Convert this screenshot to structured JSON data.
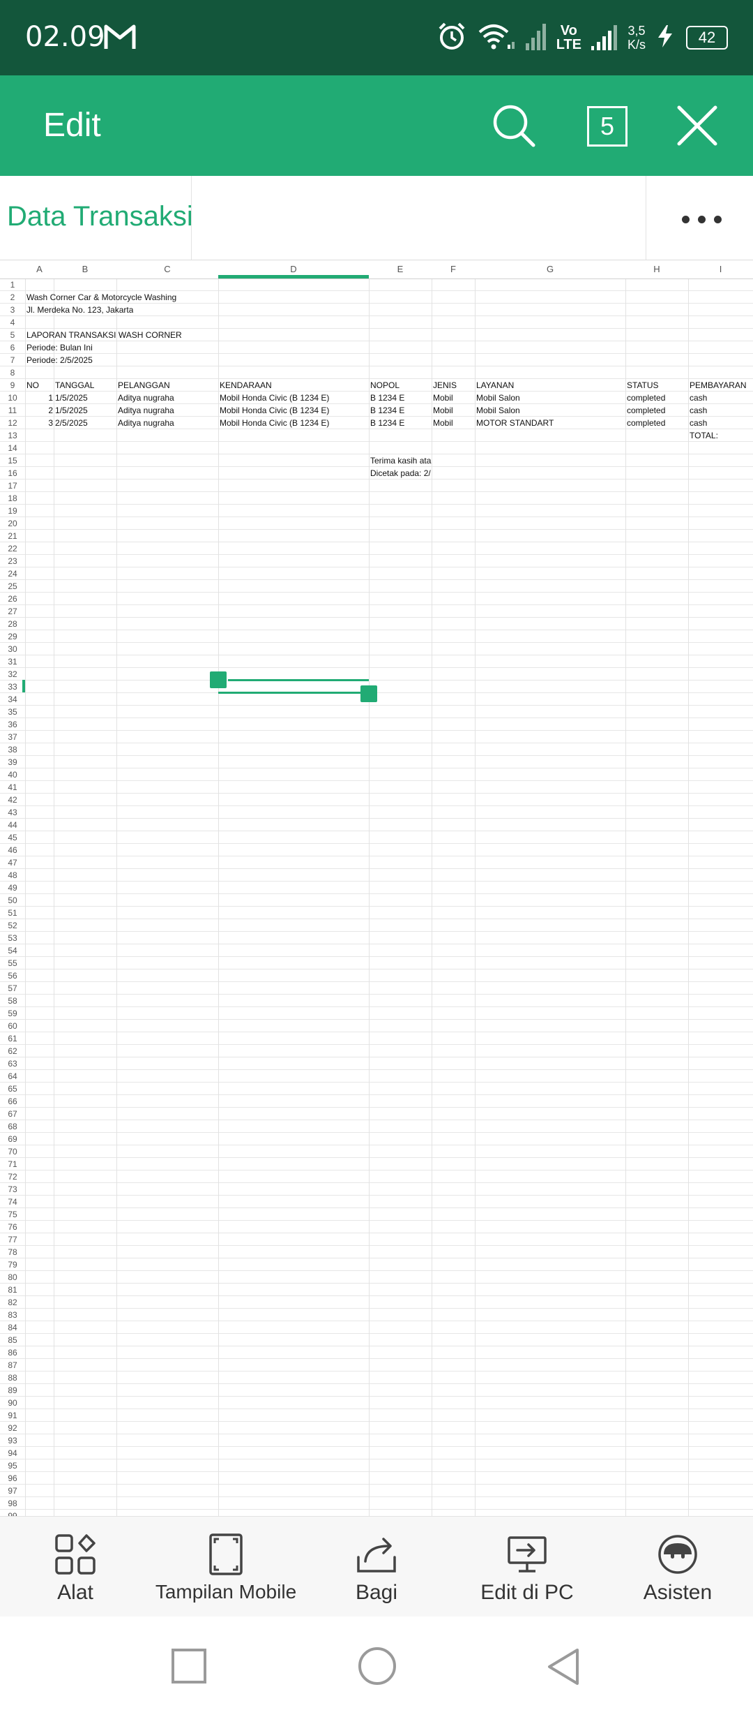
{
  "status_bar": {
    "time": "02.09",
    "speed_value": "3,5",
    "speed_unit": "K/s",
    "volte_top": "Vo",
    "volte_bottom": "LTE",
    "battery": "42"
  },
  "app_bar": {
    "title": "Edit",
    "tabs_count": "5"
  },
  "sheet": {
    "tab_name": "Data Transaksi"
  },
  "columns": [
    "A",
    "B",
    "C",
    "D",
    "E",
    "F",
    "G",
    "H",
    "I"
  ],
  "active_cell": {
    "row": 33,
    "column": "D"
  },
  "cells": {
    "r2_a": "Wash Corner Car & Motorcycle Washing",
    "r3_a": "Jl. Merdeka No. 123, Jakarta",
    "r5_a": "LAPORAN TRANSAKSI WASH CORNER",
    "r6_a": "Periode: Bulan Ini",
    "r7_a": "Periode: 2/5/2025",
    "r15_e": "Terima kasih ata",
    "r16_e": "Dicetak pada: 2/",
    "r13_i": "TOTAL:"
  },
  "table": {
    "headers": [
      "NO",
      "TANGGAL",
      "PELANGGAN",
      "KENDARAAN",
      "NOPOL",
      "JENIS",
      "LAYANAN",
      "STATUS",
      "PEMBAYARAN"
    ],
    "rows": [
      [
        "1",
        "1/5/2025",
        "Aditya nugraha",
        "Mobil Honda Civic (B 1234 E)",
        "B 1234 E",
        "Mobil",
        "Mobil Salon",
        "completed",
        "cash"
      ],
      [
        "2",
        "1/5/2025",
        "Aditya nugraha",
        "Mobil Honda Civic (B 1234 E)",
        "B 1234 E",
        "Mobil",
        "Mobil Salon",
        "completed",
        "cash"
      ],
      [
        "3",
        "2/5/2025",
        "Aditya nugraha",
        "Mobil Honda Civic (B 1234 E)",
        "B 1234 E",
        "Mobil",
        "MOTOR STANDART",
        "completed",
        "cash"
      ]
    ]
  },
  "toolbar": {
    "alat": "Alat",
    "tampilan_mobile": "Tampilan Mobile",
    "bagi": "Bagi",
    "edit_di_pc": "Edit di PC",
    "asisten": "Asisten"
  },
  "icons": {
    "accent": "#21ab74",
    "status_bar_bg": "#13563b"
  }
}
